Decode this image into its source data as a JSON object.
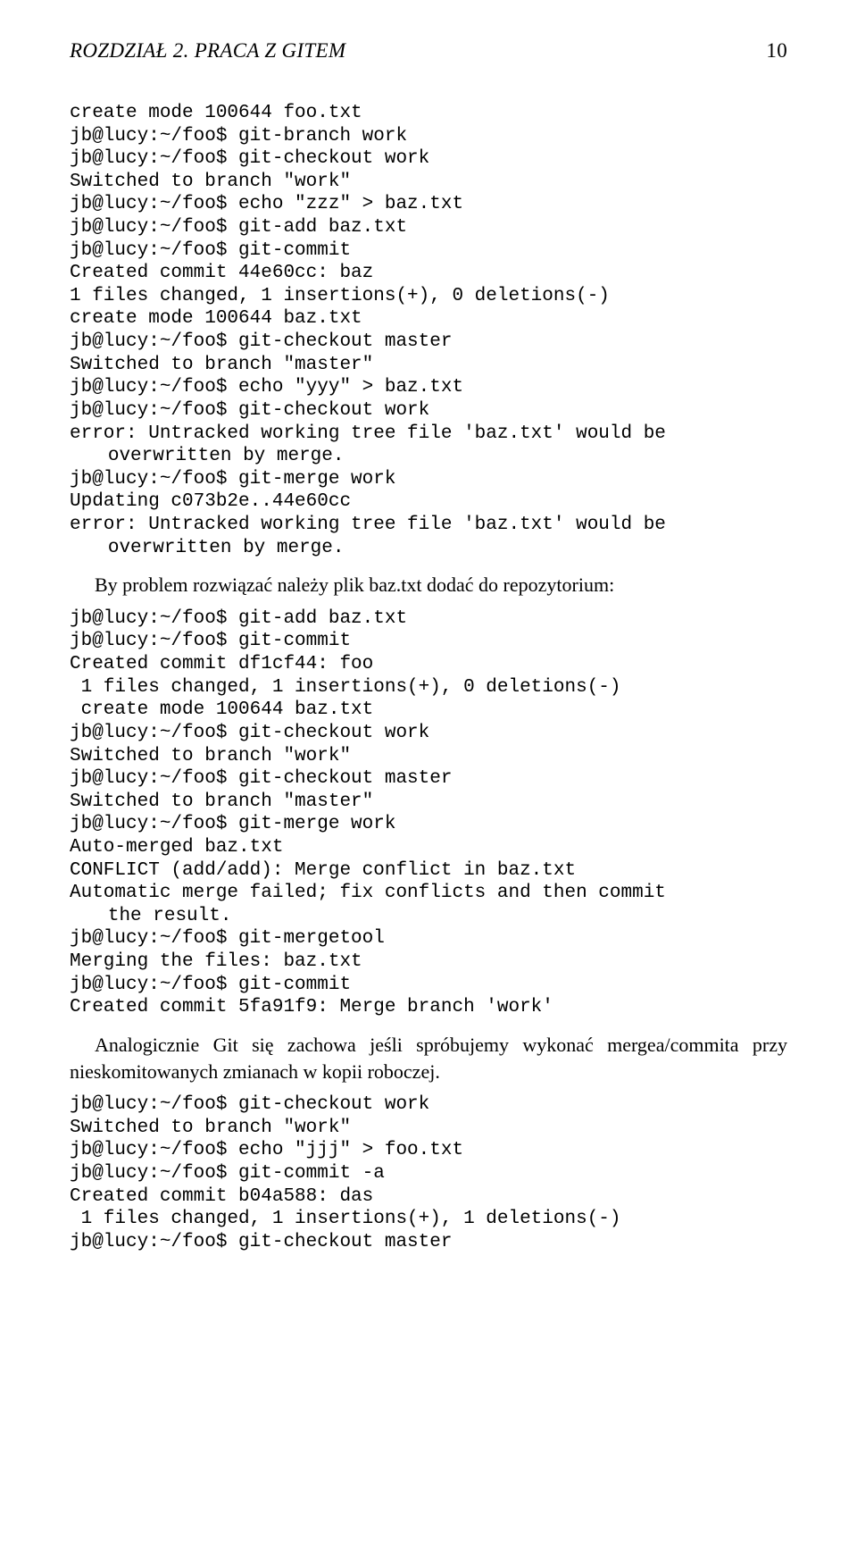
{
  "header": {
    "left": "ROZDZIAŁ 2. PRACA Z GITEM",
    "right": "10"
  },
  "block1": [
    "create mode 100644 foo.txt",
    "jb@lucy:~/foo$ git-branch work",
    "jb@lucy:~/foo$ git-checkout work",
    "Switched to branch \"work\"",
    "jb@lucy:~/foo$ echo \"zzz\" > baz.txt",
    "jb@lucy:~/foo$ git-add baz.txt",
    "jb@lucy:~/foo$ git-commit",
    "Created commit 44e60cc: baz",
    "1 files changed, 1 insertions(+), 0 deletions(-)",
    "create mode 100644 baz.txt",
    "jb@lucy:~/foo$ git-checkout master",
    "Switched to branch \"master\"",
    "jb@lucy:~/foo$ echo \"yyy\" > baz.txt",
    "jb@lucy:~/foo$ git-checkout work",
    "error: Untracked working tree file 'baz.txt' would be",
    "   overwritten by merge.",
    "jb@lucy:~/foo$ git-merge work",
    "Updating c073b2e..44e60cc",
    "error: Untracked working tree file 'baz.txt' would be",
    "   overwritten by merge."
  ],
  "para1": "By problem rozwiązać należy plik baz.txt dodać do repozytorium:",
  "block2": [
    "jb@lucy:~/foo$ git-add baz.txt",
    "jb@lucy:~/foo$ git-commit",
    "Created commit df1cf44: foo",
    " 1 files changed, 1 insertions(+), 0 deletions(-)",
    " create mode 100644 baz.txt",
    "jb@lucy:~/foo$ git-checkout work",
    "Switched to branch \"work\"",
    "jb@lucy:~/foo$ git-checkout master",
    "Switched to branch \"master\"",
    "jb@lucy:~/foo$ git-merge work",
    "Auto-merged baz.txt",
    "CONFLICT (add/add): Merge conflict in baz.txt",
    "Automatic merge failed; fix conflicts and then commit",
    "   the result.",
    "jb@lucy:~/foo$ git-mergetool",
    "Merging the files: baz.txt",
    "jb@lucy:~/foo$ git-commit",
    "Created commit 5fa91f9: Merge branch 'work'"
  ],
  "para2": "Analogicznie Git się zachowa jeśli spróbujemy wykonać mergea/commita przy nieskomitowanych zmianach w kopii roboczej.",
  "block3": [
    "jb@lucy:~/foo$ git-checkout work",
    "Switched to branch \"work\"",
    "jb@lucy:~/foo$ echo \"jjj\" > foo.txt",
    "jb@lucy:~/foo$ git-commit -a",
    "Created commit b04a588: das",
    " 1 files changed, 1 insertions(+), 1 deletions(-)",
    "jb@lucy:~/foo$ git-checkout master"
  ]
}
